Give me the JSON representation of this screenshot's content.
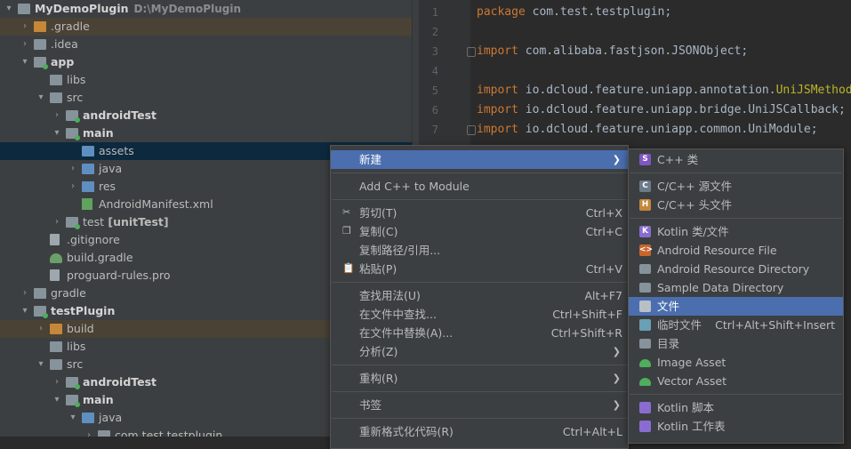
{
  "tree": {
    "rows": [
      {
        "label": "MyDemoPlugin",
        "path": "D:\\MyDemoPlugin",
        "bold": true,
        "indent": 0,
        "arrow": "▾",
        "icon": "folder-icon"
      },
      {
        "label": ".gradle",
        "indent": 1,
        "arrow": "›",
        "icon": "folder-icon",
        "color": "orange",
        "highlight": true
      },
      {
        "label": ".idea",
        "indent": 1,
        "arrow": "›",
        "icon": "folder-icon"
      },
      {
        "label": "app",
        "bold": true,
        "indent": 1,
        "arrow": "▾",
        "icon": "module-icon"
      },
      {
        "label": "libs",
        "indent": 2,
        "arrow": "",
        "icon": "folder-icon"
      },
      {
        "label": "src",
        "indent": 2,
        "arrow": "▾",
        "icon": "folder-icon"
      },
      {
        "label": "androidTest",
        "bold": true,
        "indent": 3,
        "arrow": "›",
        "icon": "module-icon"
      },
      {
        "label": "main",
        "bold": true,
        "indent": 3,
        "arrow": "▾",
        "icon": "module-icon"
      },
      {
        "label": "assets",
        "indent": 4,
        "arrow": "",
        "icon": "folder-icon",
        "color": "blue",
        "selected": true
      },
      {
        "label": "java",
        "indent": 4,
        "arrow": "›",
        "icon": "folder-icon",
        "color": "blue"
      },
      {
        "label": "res",
        "indent": 4,
        "arrow": "›",
        "icon": "folder-icon",
        "color": "blue"
      },
      {
        "label": "AndroidManifest.xml",
        "indent": 4,
        "arrow": "",
        "icon": "xml-file-icon"
      },
      {
        "label": "test",
        "suffix": "[unitTest]",
        "indent": 3,
        "arrow": "›",
        "icon": "module-icon"
      },
      {
        "label": ".gitignore",
        "indent": 2,
        "arrow": "",
        "icon": "file-icon"
      },
      {
        "label": "build.gradle",
        "indent": 2,
        "arrow": "",
        "icon": "gradle-icon"
      },
      {
        "label": "proguard-rules.pro",
        "indent": 2,
        "arrow": "",
        "icon": "file-icon"
      },
      {
        "label": "gradle",
        "indent": 1,
        "arrow": "›",
        "icon": "folder-icon"
      },
      {
        "label": "testPlugin",
        "bold": true,
        "indent": 1,
        "arrow": "▾",
        "icon": "module-icon"
      },
      {
        "label": "build",
        "indent": 2,
        "arrow": "›",
        "icon": "folder-icon",
        "color": "orange",
        "highlight": true
      },
      {
        "label": "libs",
        "indent": 2,
        "arrow": "",
        "icon": "folder-icon"
      },
      {
        "label": "src",
        "indent": 2,
        "arrow": "▾",
        "icon": "folder-icon"
      },
      {
        "label": "androidTest",
        "bold": true,
        "indent": 3,
        "arrow": "›",
        "icon": "module-icon"
      },
      {
        "label": "main",
        "bold": true,
        "indent": 3,
        "arrow": "▾",
        "icon": "module-icon"
      },
      {
        "label": "java",
        "indent": 4,
        "arrow": "▾",
        "icon": "folder-icon",
        "color": "blue"
      },
      {
        "label": "com.test.testplugin",
        "indent": 5,
        "arrow": "›",
        "icon": "package-icon"
      }
    ]
  },
  "editor": {
    "lines": [
      {
        "n": "1",
        "parts": [
          [
            "kw",
            "package "
          ],
          [
            "",
            "com.test.testplugin;"
          ]
        ]
      },
      {
        "n": "2",
        "parts": []
      },
      {
        "n": "3",
        "parts": [
          [
            "kw",
            "import "
          ],
          [
            "",
            "com.alibaba.fastjson.JSONObject;"
          ]
        ],
        "fold": true
      },
      {
        "n": "4",
        "parts": []
      },
      {
        "n": "5",
        "parts": [
          [
            "kw",
            "import "
          ],
          [
            "",
            "io.dcloud.feature.uniapp.annotation."
          ],
          [
            "ann",
            "UniJSMethod"
          ],
          [
            "",
            ";"
          ]
        ]
      },
      {
        "n": "6",
        "parts": [
          [
            "kw",
            "import "
          ],
          [
            "",
            "io.dcloud.feature.uniapp.bridge.UniJSCallback;"
          ]
        ]
      },
      {
        "n": "7",
        "parts": [
          [
            "kw",
            "import "
          ],
          [
            "",
            "io.dcloud.feature.uniapp.common.UniModule;"
          ]
        ],
        "fold": true
      }
    ]
  },
  "menu": {
    "items": [
      {
        "label": "新建",
        "shortcut": "",
        "submenu": true,
        "active": true
      },
      {
        "sep": true
      },
      {
        "label": "Add C++ to Module",
        "shortcut": ""
      },
      {
        "sep": true
      },
      {
        "label": "剪切(T)",
        "shortcut": "Ctrl+X",
        "icon": "cut-icon"
      },
      {
        "label": "复制(C)",
        "shortcut": "Ctrl+C",
        "icon": "copy-icon"
      },
      {
        "label": "复制路径/引用...",
        "shortcut": ""
      },
      {
        "label": "粘贴(P)",
        "shortcut": "Ctrl+V",
        "icon": "paste-icon"
      },
      {
        "sep": true
      },
      {
        "label": "查找用法(U)",
        "shortcut": "Alt+F7"
      },
      {
        "label": "在文件中查找...",
        "shortcut": "Ctrl+Shift+F"
      },
      {
        "label": "在文件中替换(A)...",
        "shortcut": "Ctrl+Shift+R"
      },
      {
        "label": "分析(Z)",
        "shortcut": "",
        "submenu": true
      },
      {
        "sep": true
      },
      {
        "label": "重构(R)",
        "shortcut": "",
        "submenu": true
      },
      {
        "sep": true
      },
      {
        "label": "书签",
        "shortcut": "",
        "submenu": true
      },
      {
        "sep": true
      },
      {
        "label": "重新格式化代码(R)",
        "shortcut": "Ctrl+Alt+L"
      }
    ]
  },
  "submenu": {
    "items": [
      {
        "label": "C++ 类",
        "icon": "cpp-class-icon",
        "color": "#7e57c2",
        "glyph": "S"
      },
      {
        "sep": true
      },
      {
        "label": "C/C++ 源文件",
        "icon": "cpp-source-icon",
        "color": "#6c7a89",
        "glyph": "C"
      },
      {
        "label": "C/C++ 头文件",
        "icon": "cpp-header-icon",
        "color": "#c58739",
        "glyph": "H"
      },
      {
        "sep": true
      },
      {
        "label": "Kotlin 类/文件",
        "icon": "kotlin-icon",
        "color": "#8a6cd1",
        "glyph": "K"
      },
      {
        "label": "Android Resource File",
        "icon": "android-resource-file-icon",
        "color": "#c7652d",
        "glyph": "<>"
      },
      {
        "label": "Android Resource Directory",
        "icon": "folder-icon",
        "color": "#87939a",
        "glyph": ""
      },
      {
        "label": "Sample Data Directory",
        "icon": "folder-icon",
        "color": "#87939a",
        "glyph": ""
      },
      {
        "label": "文件",
        "icon": "file-icon",
        "color": "#b8c0c6",
        "glyph": "",
        "active": true
      },
      {
        "label": "临时文件",
        "shortcut": "Ctrl+Alt+Shift+Insert",
        "icon": "scratch-file-icon",
        "color": "#6a9fb5",
        "glyph": ""
      },
      {
        "label": "目录",
        "icon": "folder-icon",
        "color": "#87939a",
        "glyph": ""
      },
      {
        "label": "Image Asset",
        "icon": "android-icon",
        "color": "#4fae5c",
        "glyph": ""
      },
      {
        "label": "Vector Asset",
        "icon": "android-icon",
        "color": "#4fae5c",
        "glyph": ""
      },
      {
        "sep": true
      },
      {
        "label": "Kotlin 脚本",
        "icon": "kotlin-script-icon",
        "color": "#8a6cd1",
        "glyph": ""
      },
      {
        "label": "Kotlin 工作表",
        "icon": "kotlin-worksheet-icon",
        "color": "#8a6cd1",
        "glyph": ""
      }
    ]
  }
}
